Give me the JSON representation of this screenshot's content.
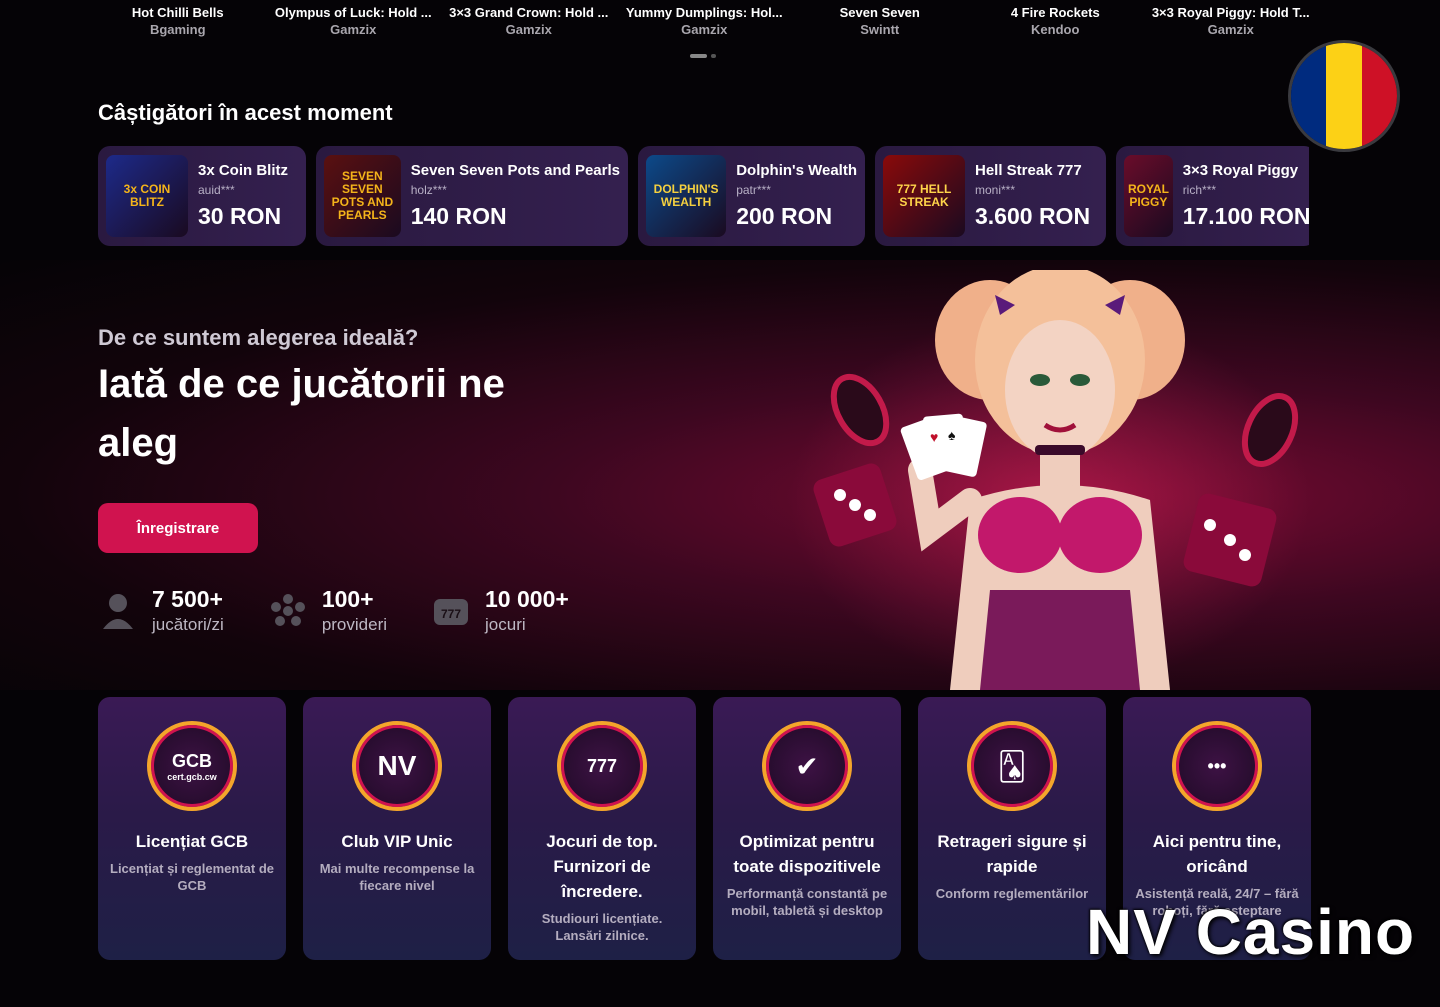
{
  "top_games": [
    {
      "title": "Hot Chilli Bells",
      "provider": "Bgaming"
    },
    {
      "title": "Olympus of Luck: Hold ...",
      "provider": "Gamzix"
    },
    {
      "title": "3×3 Grand Crown: Hold ...",
      "provider": "Gamzix"
    },
    {
      "title": "Yummy Dumplings: Hol...",
      "provider": "Gamzix"
    },
    {
      "title": "Seven Seven",
      "provider": "Swintt"
    },
    {
      "title": "4 Fire Rockets",
      "provider": "Kendoo"
    },
    {
      "title": "3×3 Royal Piggy: Hold T...",
      "provider": "Gamzix"
    }
  ],
  "flag": {
    "colors": [
      "#002b7f",
      "#fcd116",
      "#ce1126"
    ]
  },
  "winners": {
    "title": "Câștigători în acest moment",
    "items": [
      {
        "game": "3x Coin Blitz",
        "user": "auid***",
        "amount": "30 RON",
        "thumb_text": "3x COIN BLITZ",
        "thumb_color": "#1d2a8a",
        "thumb_accent": "#f4b41a"
      },
      {
        "game": "Seven Seven Pots and Pearls",
        "user": "holz***",
        "amount": "140 RON",
        "thumb_text": "SEVEN SEVEN POTS AND PEARLS",
        "thumb_color": "#5a1010",
        "thumb_accent": "#f4b41a"
      },
      {
        "game": "Dolphin's Wealth",
        "user": "patr***",
        "amount": "200 RON",
        "thumb_text": "DOLPHIN'S WEALTH",
        "thumb_color": "#0c4a8a",
        "thumb_accent": "#f4d03f"
      },
      {
        "game": "Hell Streak 777",
        "user": "moni***",
        "amount": "3.600 RON",
        "thumb_text": "777 HELL STREAK",
        "thumb_color": "#8a0a0a",
        "thumb_accent": "#ffd54a"
      },
      {
        "game": "3×3 Royal Piggy",
        "user": "rich***",
        "amount": "17.100 RON",
        "thumb_text": "ROYAL PIGGY",
        "thumb_color": "#6a0c2a",
        "thumb_accent": "#f4b41a"
      }
    ]
  },
  "hero": {
    "subtitle": "De ce suntem alegerea ideală?",
    "headline": "Iată de ce jucătorii ne aleg",
    "register_button": "Înregistrare",
    "stats": [
      {
        "number": "7 500+",
        "label": "jucători/zi",
        "icon": "user-icon"
      },
      {
        "number": "100+",
        "label": "provideri",
        "icon": "providers-icon"
      },
      {
        "number": "10 000+",
        "label": "jocuri",
        "icon": "slot-icon"
      }
    ]
  },
  "features": [
    {
      "title": "Licențiat GCB",
      "desc": "Licențiat și reglementat de GCB",
      "icon": "gcb-icon",
      "icon_text": "GCB",
      "icon_sub": "cert.gcb.cw"
    },
    {
      "title": "Club VIP Unic",
      "desc": "Mai multe recompense la fiecare nivel",
      "icon": "vip-icon",
      "icon_text": "NV"
    },
    {
      "title": "Jocuri de top. Furnizori de încredere.",
      "desc": "Studiouri licențiate. Lansări zilnice.",
      "icon": "games-icon",
      "icon_text": "777"
    },
    {
      "title": "Optimizat pentru toate dispozitivele",
      "desc": "Performanță constantă pe mobil, tabletă și desktop",
      "icon": "phone-icon",
      "icon_text": "✔"
    },
    {
      "title": "Retrageri sigure și rapide",
      "desc": "Conform reglementărilor",
      "icon": "withdrawal-icon",
      "icon_text": "🂡"
    },
    {
      "title": "Aici pentru tine, oricând",
      "desc": "Asistență reală, 24/7 – fără roboți, fără așteptare",
      "icon": "support-icon",
      "icon_text": "•••"
    }
  ],
  "watermark": "NV Casino"
}
